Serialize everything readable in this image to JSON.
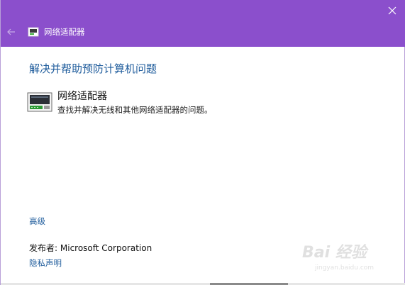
{
  "window": {
    "title": "网络适配器",
    "accent_color": "#8b4fcc",
    "close_icon": "close-icon",
    "back_icon": "back-arrow-icon"
  },
  "main": {
    "heading": "解决并帮助预防计算机问题",
    "item": {
      "icon": "network-adapter-icon",
      "title": "网络适配器",
      "description": "查找并解决无线和其他网络适配器的问题。"
    },
    "advanced_link": "高级",
    "publisher_label": "发布者:",
    "publisher_value": "Microsoft Corporation",
    "privacy_link": "隐私声明"
  },
  "watermark": {
    "main": "Bai 经验",
    "sub": "jingyan.baidu.com"
  },
  "colors": {
    "link": "#1f5c9c",
    "text": "#111111",
    "background": "#ffffff"
  }
}
